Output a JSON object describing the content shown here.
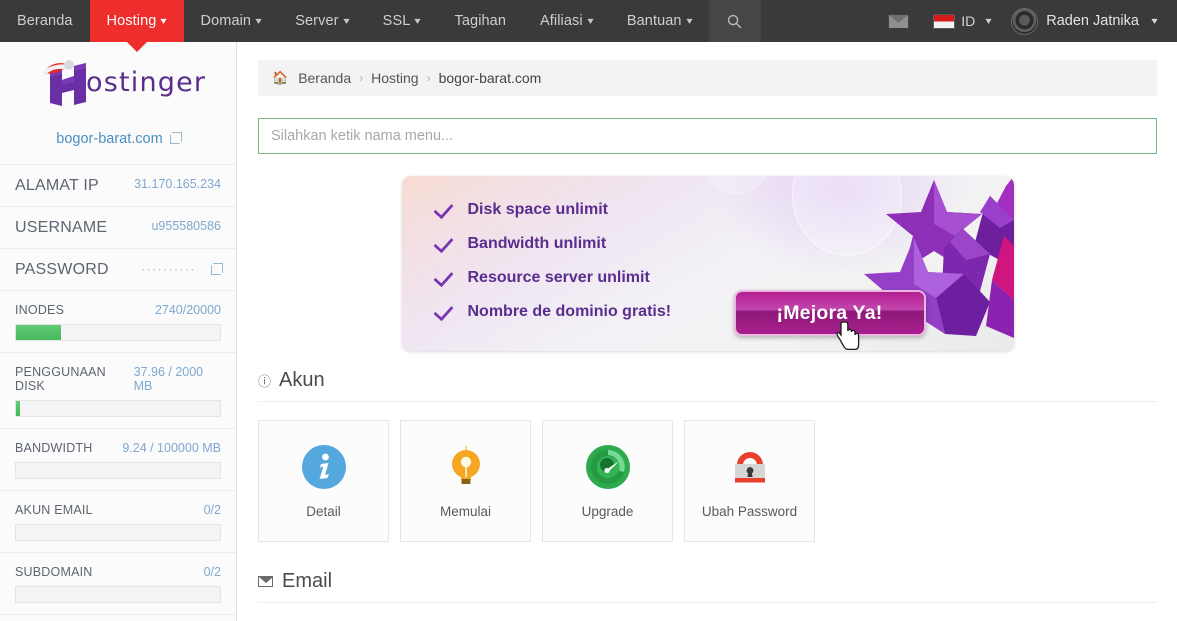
{
  "navbar": {
    "items": [
      {
        "label": "Beranda",
        "has_caret": false,
        "active": false
      },
      {
        "label": "Hosting",
        "has_caret": true,
        "active": true
      },
      {
        "label": "Domain",
        "has_caret": true,
        "active": false
      },
      {
        "label": "Server",
        "has_caret": true,
        "active": false
      },
      {
        "label": "SSL",
        "has_caret": true,
        "active": false
      },
      {
        "label": "Tagihan",
        "has_caret": false,
        "active": false
      },
      {
        "label": "Afiliasi",
        "has_caret": true,
        "active": false
      },
      {
        "label": "Bantuan",
        "has_caret": true,
        "active": false
      }
    ],
    "search_icon": "search-icon",
    "mail_icon": "envelope-icon",
    "language": "ID",
    "user_name": "Raden Jatnika",
    "active_color": "#ee2d2d",
    "background_color": "#3a3a3a"
  },
  "sidebar": {
    "logo_text": "ostinger",
    "logo_accent_color": "#5a2d8e",
    "site_domain": "bogor-barat.com",
    "stats": [
      {
        "label": "ALAMAT IP",
        "value": "31.170.165.234",
        "bar": false
      },
      {
        "label": "USERNAME",
        "value": "u955580586",
        "bar": false
      },
      {
        "label": "PASSWORD",
        "value": "··········",
        "bar": false,
        "external": true
      },
      {
        "label": "INODES",
        "value": "2740/20000",
        "bar": true,
        "percent": 14
      },
      {
        "label": "PENGGUNAAN DISK",
        "value": "37.96 / 2000 MB",
        "bar": true,
        "percent": 2
      },
      {
        "label": "BANDWIDTH",
        "value": "9.24 / 100000 MB",
        "bar": true,
        "percent": 0
      },
      {
        "label": "AKUN EMAIL",
        "value": "0/2",
        "bar": true,
        "percent": 0
      },
      {
        "label": "SUBDOMAIN",
        "value": "0/2",
        "bar": true,
        "percent": 0
      }
    ]
  },
  "breadcrumb": {
    "home_icon": "home-icon",
    "items": [
      "Beranda",
      "Hosting",
      "bogor-barat.com"
    ],
    "separator": "›"
  },
  "menu_search": {
    "placeholder": "Silahkan ketik nama menu...",
    "value": "",
    "border_color": "#7cb87c"
  },
  "banner": {
    "features": [
      "Disk space unlimit",
      "Bandwidth unlimit",
      "Resource server unlimit",
      "Nombre de dominio gratis!"
    ],
    "cta_label": "¡Mejora Ya!",
    "cta_color": "#b3208f",
    "text_color": "#5a2d8e"
  },
  "account_section": {
    "title": "Akun",
    "icon": "info-circle-icon",
    "cards": [
      {
        "label": "Detail",
        "icon": "info-icon",
        "color": "#55a8dd"
      },
      {
        "label": "Memulai",
        "icon": "lightbulb-icon",
        "color": "#f5a623"
      },
      {
        "label": "Upgrade",
        "icon": "gauge-icon",
        "color": "#2eaa4e"
      },
      {
        "label": "Ubah Password",
        "icon": "padlock-icon",
        "color": "#e8402a"
      }
    ]
  },
  "email_section": {
    "title": "Email",
    "icon": "envelope-icon"
  }
}
